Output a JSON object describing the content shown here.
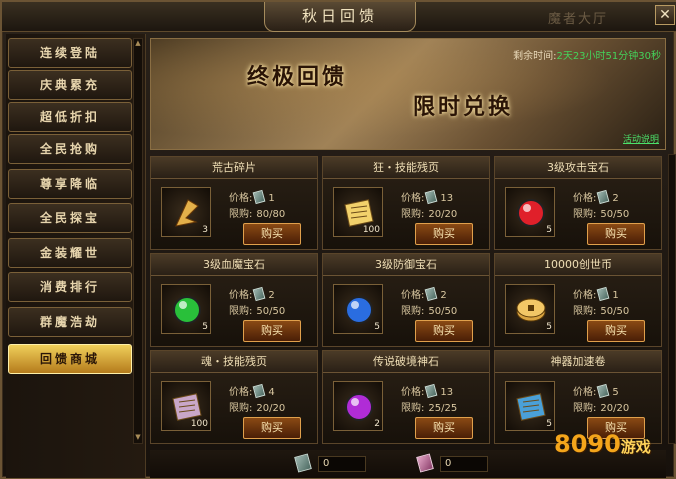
{
  "window": {
    "title": "秋日回馈",
    "watermark": "魔者大厅",
    "close_label": "✕"
  },
  "sidebar": {
    "items": [
      {
        "label": "连续登陆",
        "active": false
      },
      {
        "label": "庆典累充",
        "active": false
      },
      {
        "label": "超低折扣",
        "active": false
      },
      {
        "label": "全民抢购",
        "active": false
      },
      {
        "label": "尊享降临",
        "active": false
      },
      {
        "label": "全民探宝",
        "active": false
      },
      {
        "label": "金装耀世",
        "active": false
      },
      {
        "label": "消费排行",
        "active": false
      },
      {
        "label": "群魔浩劫",
        "active": false
      },
      {
        "label": "回馈商城",
        "active": true
      }
    ]
  },
  "banner": {
    "title_a": "终极回馈",
    "title_b": "限时兑换",
    "timer_label": "剩余时间:",
    "timer_value": "2天23小时51分钟30秒",
    "desc_link": "活动说明"
  },
  "shop": {
    "price_label": "价格:",
    "limit_label": "限购:",
    "buy_label": "购买",
    "items": [
      {
        "name": "荒古碎片",
        "price": "1",
        "limit": "80/80",
        "count": "3",
        "icon": "shard-icon",
        "color": "#e3b04a"
      },
      {
        "name": "狂・技能残页",
        "price": "13",
        "limit": "20/20",
        "count": "100",
        "icon": "scroll-page-icon",
        "color": "#f2d16b"
      },
      {
        "name": "3级攻击宝石",
        "price": "2",
        "limit": "50/50",
        "count": "5",
        "icon": "red-gem-icon",
        "color": "#e0202a"
      },
      {
        "name": "3级血魔宝石",
        "price": "2",
        "limit": "50/50",
        "count": "5",
        "icon": "green-gem-icon",
        "color": "#29c03a"
      },
      {
        "name": "3级防御宝石",
        "price": "2",
        "limit": "50/50",
        "count": "5",
        "icon": "blue-gem-icon",
        "color": "#2a6de0"
      },
      {
        "name": "10000创世币",
        "price": "1",
        "limit": "50/50",
        "count": "5",
        "icon": "coin-icon",
        "color": "#d9a441"
      },
      {
        "name": "魂・技能残页",
        "price": "4",
        "limit": "20/20",
        "count": "100",
        "icon": "soul-page-icon",
        "color": "#c9a7c8"
      },
      {
        "name": "传说破境神石",
        "price": "13",
        "limit": "25/25",
        "count": "2",
        "icon": "purple-stone-icon",
        "color": "#b02cd6"
      },
      {
        "name": "神器加速卷",
        "price": "5",
        "limit": "20/20",
        "count": "5",
        "icon": "speed-scroll-icon",
        "color": "#4aa0d8"
      }
    ]
  },
  "footer": {
    "wallet_a": "0",
    "wallet_b": "0"
  },
  "logo": {
    "text": "8090",
    "suffix": "游戏"
  }
}
